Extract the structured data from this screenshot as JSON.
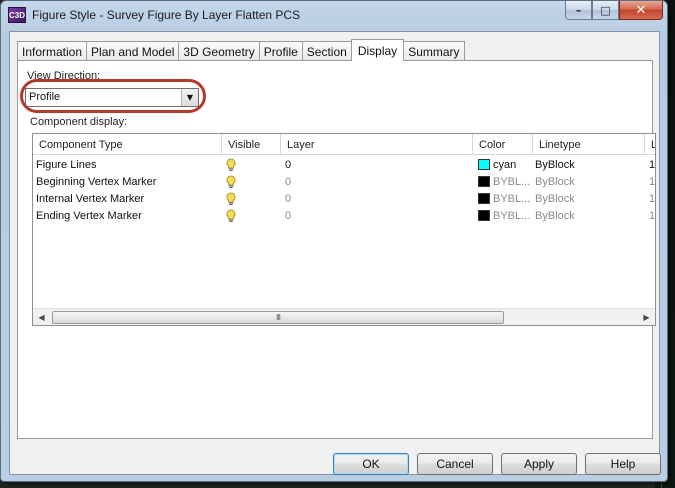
{
  "window": {
    "title": "Figure Style - Survey Figure By Layer Flatten PCS",
    "app_icon_text": "C3D"
  },
  "caption_buttons": {
    "minimize": "–",
    "maximize": "□",
    "close": "✕"
  },
  "tabs": [
    {
      "label": "Information",
      "active": false
    },
    {
      "label": "Plan and Model",
      "active": false
    },
    {
      "label": "3D Geometry",
      "active": false
    },
    {
      "label": "Profile",
      "active": false
    },
    {
      "label": "Section",
      "active": false
    },
    {
      "label": "Display",
      "active": true
    },
    {
      "label": "Summary",
      "active": false
    }
  ],
  "view_direction": {
    "label": "View Direction:",
    "value": "Profile"
  },
  "component_display": {
    "label": "Component display:",
    "columns": [
      "Component Type",
      "Visible",
      "Layer",
      "Color",
      "Linetype",
      "L"
    ],
    "rows": [
      {
        "type": "Figure Lines",
        "visible": true,
        "layer": "0",
        "color_name": "cyan",
        "color_hex": "#00ffff",
        "linetype": "ByBlock",
        "l": "1",
        "dim": false
      },
      {
        "type": "Beginning Vertex Marker",
        "visible": true,
        "layer": "0",
        "color_name": "BYBL...",
        "color_hex": "#000000",
        "linetype": "ByBlock",
        "l": "1",
        "dim": true
      },
      {
        "type": "Internal Vertex Marker",
        "visible": true,
        "layer": "0",
        "color_name": "BYBL...",
        "color_hex": "#000000",
        "linetype": "ByBlock",
        "l": "1",
        "dim": true
      },
      {
        "type": "Ending Vertex Marker",
        "visible": true,
        "layer": "0",
        "color_name": "BYBL...",
        "color_hex": "#000000",
        "linetype": "ByBlock",
        "l": "1",
        "dim": true
      }
    ],
    "scroll_thumb": "III"
  },
  "buttons": {
    "ok": "OK",
    "cancel": "Cancel",
    "apply": "Apply",
    "help": "Help"
  },
  "colors": {
    "highlight_ring": "#b23a2c",
    "bulb": "#f2d24a"
  }
}
